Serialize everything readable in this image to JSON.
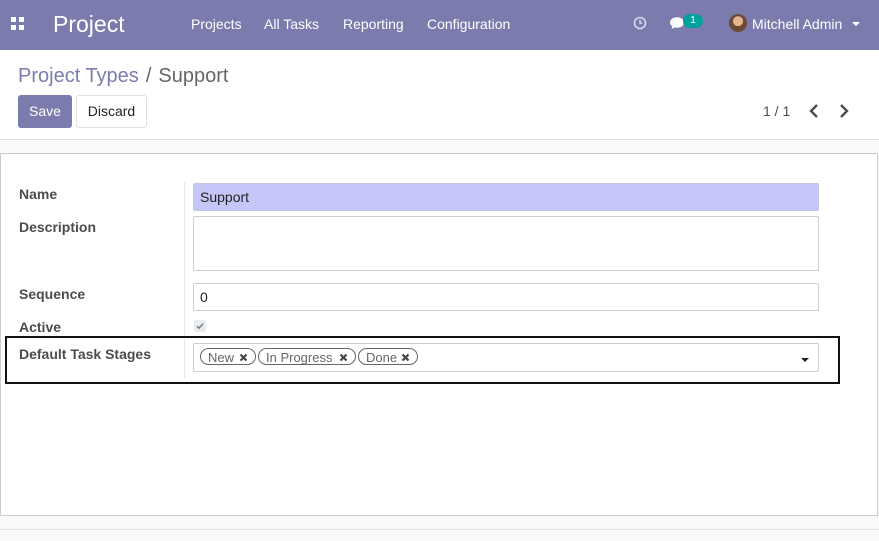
{
  "navbar": {
    "brand": "Project",
    "menu": [
      "Projects",
      "All Tasks",
      "Reporting",
      "Configuration"
    ],
    "chat_count": "1",
    "user_name": "Mitchell Admin"
  },
  "breadcrumb": {
    "parent": "Project Types",
    "separator": "/",
    "current": "Support"
  },
  "buttons": {
    "save": "Save",
    "discard": "Discard"
  },
  "pager": {
    "value": "1 / 1"
  },
  "form": {
    "name_label": "Name",
    "name_value": "Support",
    "description_label": "Description",
    "description_value": "",
    "sequence_label": "Sequence",
    "sequence_value": "0",
    "active_label": "Active",
    "active_checked": true,
    "stages_label": "Default Task Stages",
    "stages": [
      "New",
      "In Progress",
      "Done"
    ]
  },
  "colors": {
    "brand": "#7c7bad",
    "badge": "#00a09d",
    "name_input_bg": "#c6c6f8"
  }
}
